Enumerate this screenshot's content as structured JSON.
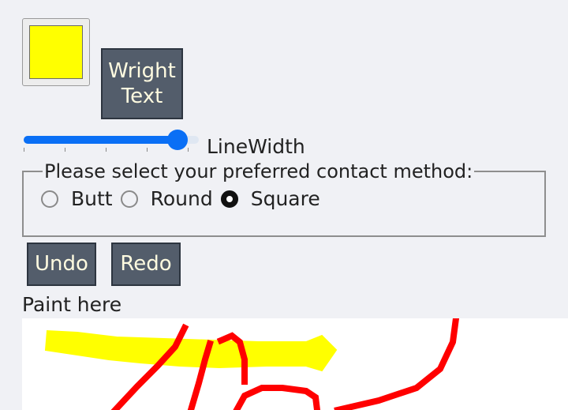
{
  "colors": {
    "accent": "#0a6ff5",
    "button_bg": "#535d6b",
    "button_text": "#fffbe0",
    "selected_color": "#ffff00",
    "stroke_red": "#ff0000"
  },
  "toolbar": {
    "color_swatch": {
      "value": "#ffff00"
    },
    "write_text_label": "Wright Text"
  },
  "line_width": {
    "label": "LineWidth",
    "value_fraction": 0.88
  },
  "line_cap": {
    "legend": "Please select your preferred contact method:",
    "options": [
      {
        "label": "Butt",
        "checked": false
      },
      {
        "label": "Round",
        "checked": false
      },
      {
        "label": "Square",
        "checked": true
      }
    ]
  },
  "history": {
    "undo_label": "Undo",
    "redo_label": "Redo"
  },
  "canvas": {
    "label": "Paint here"
  }
}
